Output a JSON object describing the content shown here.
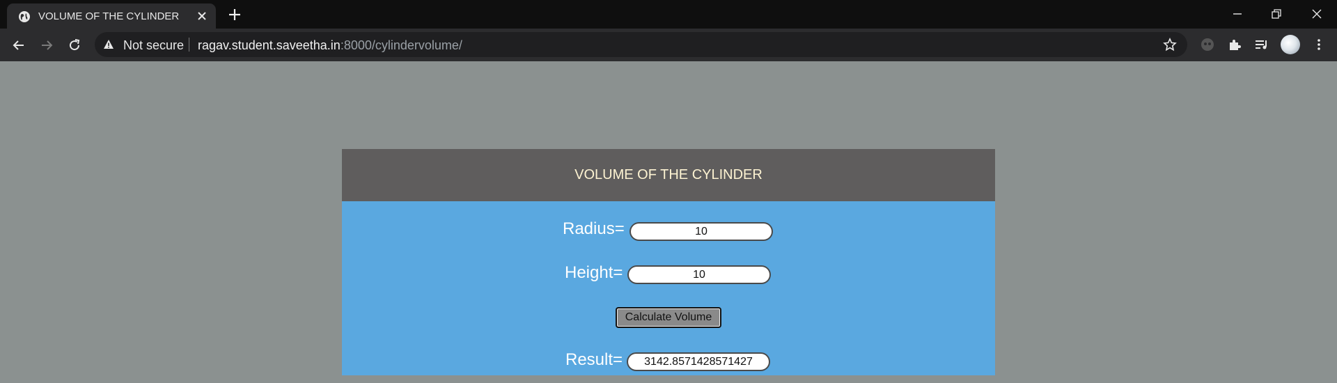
{
  "browser": {
    "tab_title": "VOLUME OF THE CYLINDER",
    "security_label": "Not secure",
    "url_host": "ragav.student.saveetha.in",
    "url_path": ":8000/cylindervolume/"
  },
  "page": {
    "title": "VOLUME OF THE CYLINDER",
    "radius_label": "Radius=",
    "radius_value": "10",
    "height_label": "Height=",
    "height_value": "10",
    "calculate_label": "Calculate Volume",
    "result_label": "Result=",
    "result_value": "3142.8571428571427"
  },
  "colors": {
    "page_background": "#8b9190",
    "card_background": "#5aa8e0",
    "header_background": "#5f5d5d",
    "header_text": "#fdf3d2"
  }
}
